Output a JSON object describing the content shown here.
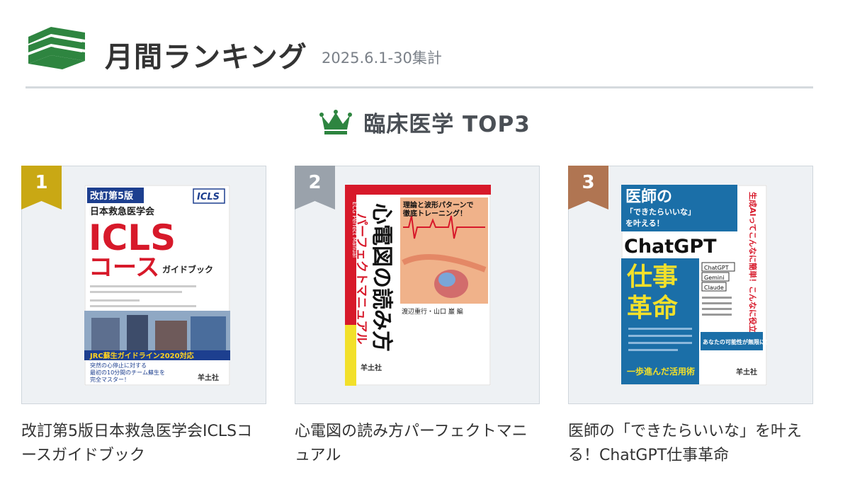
{
  "header": {
    "title": "月間ランキング",
    "period": "2025.6.1-30集計",
    "icon": "books-icon"
  },
  "category": {
    "label": "臨床医学 TOP3",
    "icon": "crown-icon"
  },
  "colors": {
    "brand_green": "#2e8540",
    "rank1": "#c9a814",
    "rank2": "#9aa2ab",
    "rank3": "#b07552"
  },
  "books": [
    {
      "rank": "1",
      "title": "改訂第5版日本救急医学会ICLSコースガイドブック",
      "cover": {
        "edition": "改訂第5版",
        "badge": "ICLS",
        "society": "日本救急医学会",
        "big1": "ICLS",
        "big2": "コース",
        "sub": "ガイドブック",
        "band": "JRC蘇生ガイドライン2020対応",
        "tagline1": "突然の心停止に対する",
        "tagline2": "最初の10分間のチーム蘇生を",
        "tagline3": "完全マスター！",
        "publisher": "羊土社"
      }
    },
    {
      "rank": "2",
      "title": "心電図の読み方パーフェクトマニュアル",
      "cover": {
        "side_en": "ECG Perfect Manual",
        "tag1": "理論と波形パターンで",
        "tag2": "徹底トレーニング！",
        "main1": "心電図の読み方",
        "main2": "パーフェクトマニュアル",
        "author": "渡辺重行・山口 巖 編",
        "publisher": "羊土社"
      }
    },
    {
      "rank": "3",
      "title": "医師の「できたらいいな」を叶える！ChatGPT仕事革命",
      "cover": {
        "head1": "医師の",
        "head2": "「できたらいいな」",
        "head3": "を叶える！",
        "brand": "ChatGPT",
        "big1": "仕事",
        "big2": "革命",
        "ai1": "ChatGPT",
        "ai2": "Gemini",
        "ai3": "Claude",
        "side_text": "生成AIってこんなに簡単！こんなに役立つ！",
        "band": "あなたの可能性が無限に広がる!!",
        "footer": "一歩進んだ活用術",
        "publisher": "羊土社"
      }
    }
  ]
}
